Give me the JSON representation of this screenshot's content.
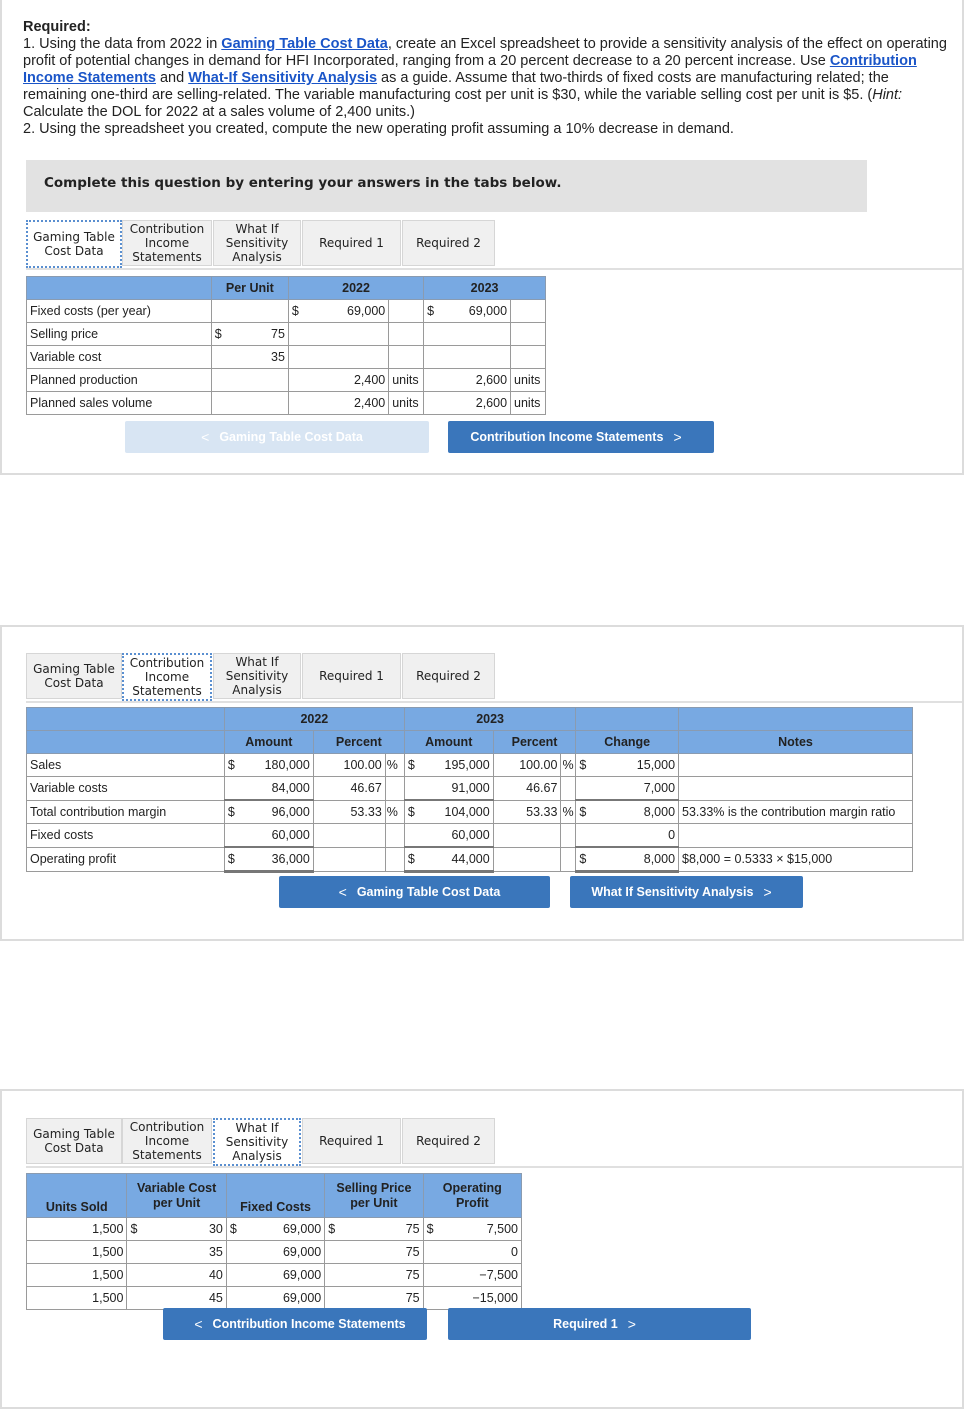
{
  "instructions": {
    "heading": "Required:",
    "line1_pre": "1. Using the data from 2022 in ",
    "link_gaming": "Gaming Table Cost Data",
    "line1_post": ", create an Excel spreadsheet to provide a sensitivity analysis of the effect on operating profit of potential changes in demand for HFI Incorporated, ranging from a 20 percent decrease to a 20 percent increase. Use ",
    "link_contribution": "Contribution Income Statements",
    "and": " and ",
    "link_whatif": "What-If Sensitivity Analysis",
    "line1_post2": " as a guide. Assume that two-thirds of fixed costs are manufacturing related; the remaining one-third are selling-related. The variable manufacturing cost per unit is $30, while the variable selling cost per unit is $5. (",
    "hint_label": "Hint:",
    "hint_text": " Calculate the DOL for 2022 at a sales volume of 2,400 units.)",
    "line2": "2. Using the spreadsheet you created, compute the new operating profit assuming a 10% decrease in demand."
  },
  "complete_banner": "Complete this question by entering your answers in the tabs below.",
  "tabs": [
    {
      "label": "Gaming Table Cost Data"
    },
    {
      "label": "Contribution Income Statements"
    },
    {
      "label": "What If Sensitivity Analysis"
    },
    {
      "label": "Required 1"
    },
    {
      "label": "Required 2"
    }
  ],
  "panel1": {
    "active_tab": 0,
    "headers": {
      "per_unit": "Per Unit",
      "y2022": "2022",
      "y2023": "2023"
    },
    "rows": [
      {
        "label": "Fixed costs (per year)",
        "pu_sym": "",
        "pu": "",
        "a_sym": "$",
        "a": "69,000",
        "a_unit": "",
        "b_sym": "$",
        "b": "69,000",
        "b_unit": ""
      },
      {
        "label": "Selling price",
        "pu_sym": "$",
        "pu": "75",
        "a_sym": "",
        "a": "",
        "a_unit": "",
        "b_sym": "",
        "b": "",
        "b_unit": ""
      },
      {
        "label": "Variable cost",
        "pu_sym": "",
        "pu": "35",
        "a_sym": "",
        "a": "",
        "a_unit": "",
        "b_sym": "",
        "b": "",
        "b_unit": ""
      },
      {
        "label": "Planned production",
        "pu_sym": "",
        "pu": "",
        "a_sym": "",
        "a": "2,400",
        "a_unit": "units",
        "b_sym": "",
        "b": "2,600",
        "b_unit": "units"
      },
      {
        "label": "Planned sales volume",
        "pu_sym": "",
        "pu": "",
        "a_sym": "",
        "a": "2,400",
        "a_unit": "units",
        "b_sym": "",
        "b": "2,600",
        "b_unit": "units"
      }
    ],
    "prev_button": "Gaming Table Cost Data",
    "next_button": "Contribution Income Statements"
  },
  "panel2": {
    "active_tab": 1,
    "headers": {
      "y2022": "2022",
      "y2023": "2023",
      "amount": "Amount",
      "percent": "Percent",
      "change": "Change",
      "notes": "Notes"
    },
    "rows": [
      {
        "label": "Sales",
        "a_sym": "$",
        "a": "180,000",
        "ap": "100.00",
        "ap_sym": "%",
        "b_sym": "$",
        "b": "195,000",
        "bp": "100.00",
        "bp_sym": "%",
        "c_sym": "$",
        "c": "15,000",
        "note": ""
      },
      {
        "label": "Variable costs",
        "a_sym": "",
        "a": "84,000",
        "ap": "46.67",
        "ap_sym": "",
        "b_sym": "",
        "b": "91,000",
        "bp": "46.67",
        "bp_sym": "",
        "c_sym": "",
        "c": "7,000",
        "note": ""
      },
      {
        "label": "Total contribution margin",
        "a_sym": "$",
        "a": "96,000",
        "ap": "53.33",
        "ap_sym": "%",
        "b_sym": "$",
        "b": "104,000",
        "bp": "53.33",
        "bp_sym": "%",
        "c_sym": "$",
        "c": "8,000",
        "note": "53.33% is the contribution margin ratio"
      },
      {
        "label": "Fixed costs",
        "a_sym": "",
        "a": "60,000",
        "ap": "",
        "ap_sym": "",
        "b_sym": "",
        "b": "60,000",
        "bp": "",
        "bp_sym": "",
        "c_sym": "",
        "c": "0",
        "note": ""
      },
      {
        "label": "Operating profit",
        "a_sym": "$",
        "a": "36,000",
        "ap": "",
        "ap_sym": "",
        "b_sym": "$",
        "b": "44,000",
        "bp": "",
        "bp_sym": "",
        "c_sym": "$",
        "c": "8,000",
        "note": "$8,000 = 0.5333 × $15,000"
      }
    ],
    "prev_button": "Gaming Table Cost Data",
    "next_button": "What If Sensitivity Analysis"
  },
  "panel3": {
    "active_tab": 2,
    "headers": {
      "units": "Units Sold",
      "varcost": "Variable Cost per Unit",
      "fixed": "Fixed Costs",
      "price": "Selling Price per Unit",
      "profit": "Operating Profit"
    },
    "rows": [
      {
        "units": "1,500",
        "v_sym": "$",
        "v": "30",
        "f_sym": "$",
        "f": "69,000",
        "p_sym": "$",
        "p": "75",
        "o_sym": "$",
        "o": "7,500"
      },
      {
        "units": "1,500",
        "v_sym": "",
        "v": "35",
        "f_sym": "",
        "f": "69,000",
        "p_sym": "",
        "p": "75",
        "o_sym": "",
        "o": "0"
      },
      {
        "units": "1,500",
        "v_sym": "",
        "v": "40",
        "f_sym": "",
        "f": "69,000",
        "p_sym": "",
        "p": "75",
        "o_sym": "",
        "o": "−7,500"
      },
      {
        "units": "1,500",
        "v_sym": "",
        "v": "45",
        "f_sym": "",
        "f": "69,000",
        "p_sym": "",
        "p": "75",
        "o_sym": "",
        "o": "−15,000"
      }
    ],
    "prev_button": "Contribution Income Statements",
    "next_button": "Required 1"
  },
  "icons": {
    "chevron_left": "<",
    "chevron_right": ">"
  }
}
